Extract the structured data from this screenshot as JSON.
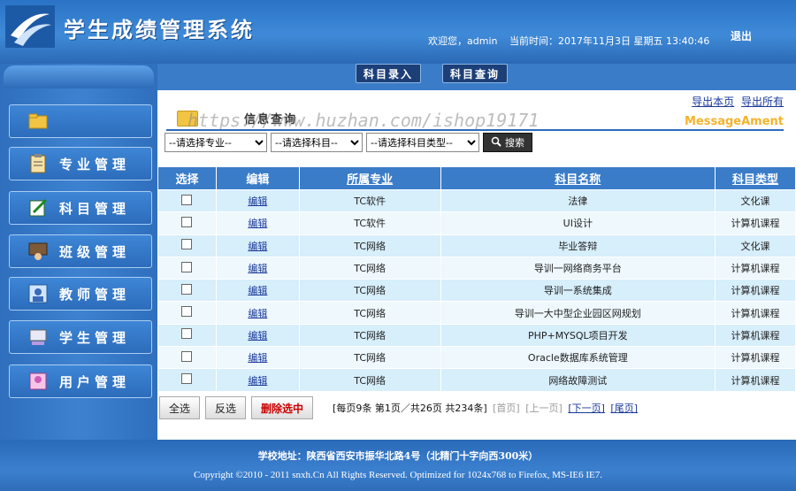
{
  "header": {
    "app_title": "学生成绩管理系统",
    "welcome": "欢迎您，admin",
    "time": "当前时间：2017年11月3日 星期五 13:40:46",
    "logout": "退出"
  },
  "sidebar": {
    "items": [
      {
        "label": "",
        "icon": "folder-icon"
      },
      {
        "label": "专业管理",
        "icon": "clipboard-icon"
      },
      {
        "label": "科目管理",
        "icon": "edit-icon"
      },
      {
        "label": "班级管理",
        "icon": "classroom-icon"
      },
      {
        "label": "教师管理",
        "icon": "teacher-icon"
      },
      {
        "label": "学生管理",
        "icon": "student-icon"
      },
      {
        "label": "用户管理",
        "icon": "user-icon"
      }
    ]
  },
  "topbar": {
    "tab_entry": "科目录入",
    "tab_query": "科目查询"
  },
  "export": {
    "page": "导出本页",
    "all": "导出所有"
  },
  "section": {
    "label": "信息查询",
    "brand": "MessageAment",
    "watermark": "https://www.huzhan.com/ishop19171"
  },
  "filters": {
    "major": "--请选择专业--",
    "subject": "--请选择科目--",
    "subject_type": "--请选择科目类型--",
    "search": "搜索"
  },
  "table": {
    "headers": [
      "选择",
      "编辑",
      "所属专业",
      "科目名称",
      "科目类型"
    ],
    "edit_label": "编辑",
    "rows": [
      {
        "major": "TC软件",
        "name": "法律",
        "type": "文化课"
      },
      {
        "major": "TC软件",
        "name": "UI设计",
        "type": "计算机课程"
      },
      {
        "major": "TC网络",
        "name": "毕业答辩",
        "type": "文化课"
      },
      {
        "major": "TC网络",
        "name": "导训一网络商务平台",
        "type": "计算机课程"
      },
      {
        "major": "TC网络",
        "name": "导训一系统集成",
        "type": "计算机课程"
      },
      {
        "major": "TC网络",
        "name": "导训一大中型企业园区网规划",
        "type": "计算机课程"
      },
      {
        "major": "TC网络",
        "name": "PHP+MYSQL项目开发",
        "type": "计算机课程"
      },
      {
        "major": "TC网络",
        "name": "Oracle数据库系统管理",
        "type": "计算机课程"
      },
      {
        "major": "TC网络",
        "name": "网络故障测试",
        "type": "计算机课程"
      }
    ]
  },
  "actions": {
    "select_all": "全选",
    "invert": "反选",
    "delete": "删除选中"
  },
  "pager": {
    "summary": "[每页9条 第1页／共26页 共234条]",
    "first": "[首页]",
    "prev": "[上一页]",
    "next": "[下一页]",
    "last": "[尾页]"
  },
  "footer": {
    "address": "学校地址：陕西省西安市振华北路4号（北精门十字向西300米）",
    "copyright": "Copyright ©2010 - 2011 snxh.Cn All Rights Reserved. Optimized for 1024x768 to Firefox, MS-IE6 IE7."
  }
}
